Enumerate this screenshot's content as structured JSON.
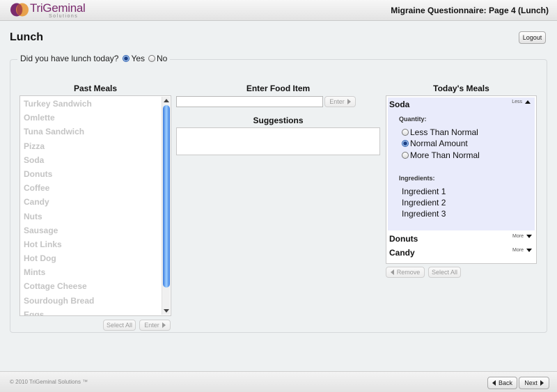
{
  "header": {
    "brand": "TriGeminal",
    "brand_sub": "Solutions",
    "page_heading": "Migraine Questionnaire: Page 4 (Lunch)",
    "logo_colors": {
      "purple": "#7a2b6e",
      "orange": "#e89a3c"
    }
  },
  "title": "Lunch",
  "logout_label": "Logout",
  "lunch_question": {
    "label": "Did you have lunch today?",
    "options": [
      "Yes",
      "No"
    ],
    "selected": "Yes"
  },
  "past_meals": {
    "heading": "Past Meals",
    "items": [
      "Turkey Sandwich",
      "Omlette",
      "Tuna Sandwich",
      "Pizza",
      "Soda",
      "Donuts",
      "Coffee",
      "Candy",
      "Nuts",
      "Sausage",
      "Hot Links",
      "Hot Dog",
      "Mints",
      "Cottage Cheese",
      "Sourdough Bread",
      "Eggs"
    ],
    "select_all_label": "Select All",
    "enter_label": "Enter"
  },
  "enter_food": {
    "heading": "Enter Food Item",
    "value": "",
    "enter_label": "Enter",
    "suggestions_heading": "Suggestions"
  },
  "todays_meals": {
    "heading": "Today's Meals",
    "expanded": {
      "name": "Soda",
      "toggle": "Less",
      "quantity_label": "Quantity:",
      "quantity_options": [
        "Less Than Normal",
        "Normal Amount",
        "More Than Normal"
      ],
      "quantity_selected": "Normal Amount",
      "ingredients_label": "Ingredients:",
      "ingredients": [
        "Ingredient 1",
        "Ingredient 2",
        "Ingredient 3"
      ]
    },
    "collapsed": [
      {
        "name": "Donuts",
        "toggle": "More"
      },
      {
        "name": "Candy",
        "toggle": "More"
      }
    ],
    "remove_label": "Remove",
    "select_all_label": "Select All"
  },
  "footer": {
    "copyright": "© 2010 TriGeminal Solutions ™",
    "back_label": "Back",
    "next_label": "Next"
  }
}
